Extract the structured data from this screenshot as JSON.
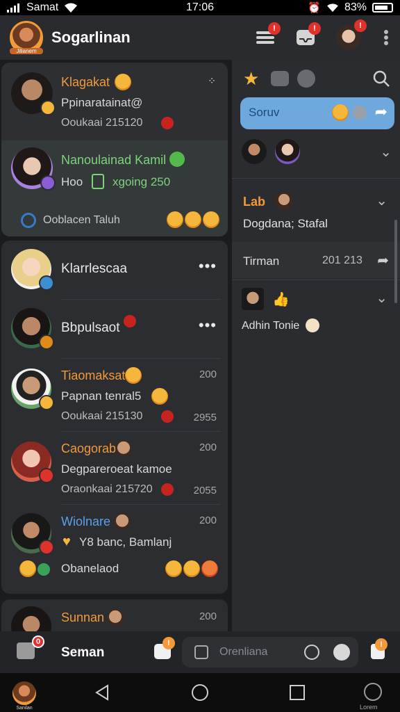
{
  "status_bar": {
    "carrier": "Samat",
    "time": "17:06",
    "battery": "83%"
  },
  "header": {
    "title": "Sogarlinan",
    "app_avatar_label": "Jilianem"
  },
  "left_top_card": {
    "row1": {
      "name": "Klagakat",
      "subtitle": "Ppinaratainat@",
      "meta": "Ooukaai 215120"
    },
    "row2": {
      "name": "Nanoulainad Kamil",
      "subtitle_a": "Hoo",
      "subtitle_b": "xgoing 250",
      "footer": "Ooblacen Taluh"
    }
  },
  "left_list_card": {
    "rows": [
      {
        "name": "Klarrlescaa"
      },
      {
        "name": "Bbpulsaot"
      },
      {
        "name": "Tiaomaksat",
        "num": "200",
        "subtitle": "Papnan tenral5",
        "meta": "Ooukaai 215130",
        "meta_num": "2955"
      },
      {
        "name": "Caogorab",
        "num": "200",
        "subtitle": "Degpareroeat kamoe",
        "meta": "Oraonkaai 215720",
        "meta_num": "2055"
      },
      {
        "name": "Wiolnare",
        "num": "200",
        "subtitle": "Y8 banc, Bamlanj",
        "footer": "Obanelaod"
      }
    ]
  },
  "left_partial_card": {
    "name": "Sunnan",
    "num": "200"
  },
  "right_panel": {
    "chip_label": "Soruv",
    "section_lab": {
      "title": "Lab",
      "subtitle": "Dogdana; Stafal"
    },
    "section_tirman": {
      "label": "Tirman",
      "value": "201 213"
    },
    "section_adhin": {
      "label": "Adhin Tonie"
    }
  },
  "bottom_bar": {
    "label": "Seman",
    "search_placeholder": "Orenliana"
  },
  "nav": {
    "left_avatar_label": "Sanilan",
    "right_label": "Lorem"
  },
  "colors": {
    "accent_orange": "#f29a3a",
    "accent_green": "#7ed37a",
    "accent_blue": "#5aa0e6",
    "chip_blue": "#6fa8dc",
    "badge_red": "#e0322d"
  }
}
